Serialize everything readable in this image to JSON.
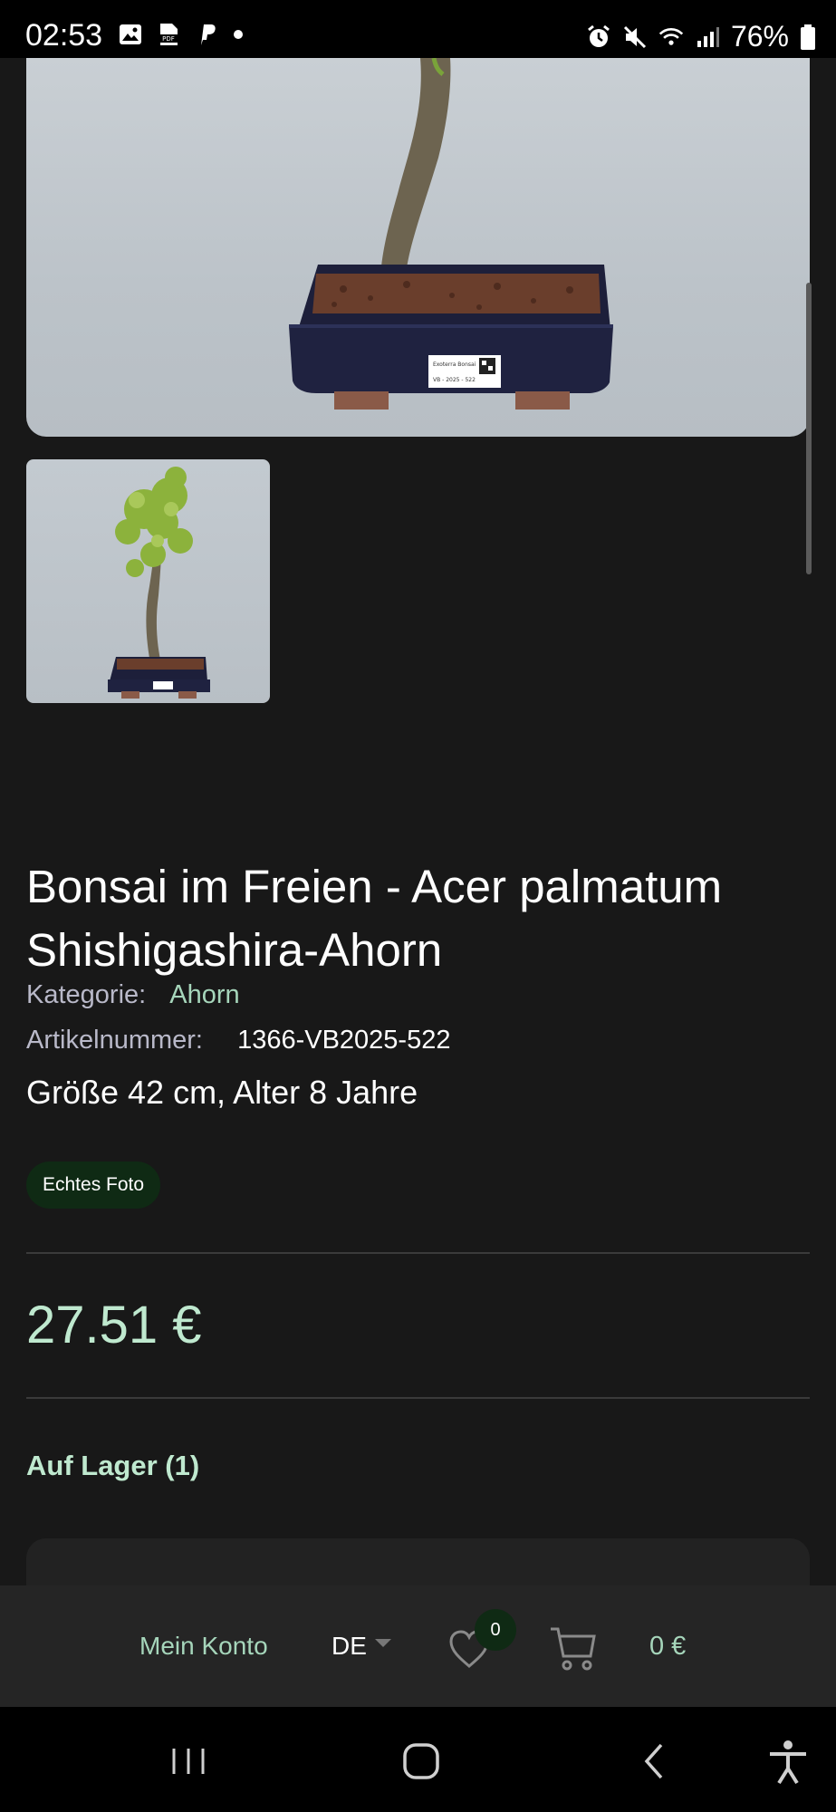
{
  "status_bar": {
    "time": "02:53",
    "battery": "76%",
    "left_icons": [
      "image-icon",
      "pdf-icon",
      "paypal-icon",
      "dot-icon"
    ],
    "right_icons": [
      "alarm-icon",
      "mute-icon",
      "wifi-icon",
      "signal-icon",
      "battery-icon"
    ]
  },
  "product": {
    "title": "Bonsai im Freien - Acer palmatum Shishigashira-Ahorn",
    "category_label": "Kategorie:",
    "category_value": "Ahorn",
    "sku_label": "Artikelnummer:",
    "sku_value": "1366-VB2025-522",
    "size_age": "Größe 42 cm, Alter 8 Jahre",
    "badge": "Echtes Foto",
    "price": "27.51 €",
    "stock": "Auf Lager (1)",
    "pot_label_line1": "Exoterra Bonsai",
    "pot_label_line2": "VB - 2025 - 522"
  },
  "shop_bar": {
    "account": "Mein Konto",
    "language": "DE",
    "wishlist_count": "0",
    "cart_total": "0 €"
  },
  "colors": {
    "background": "#181818",
    "accent_green": "#a6d6bb",
    "badge_bg": "#0f2a14"
  }
}
